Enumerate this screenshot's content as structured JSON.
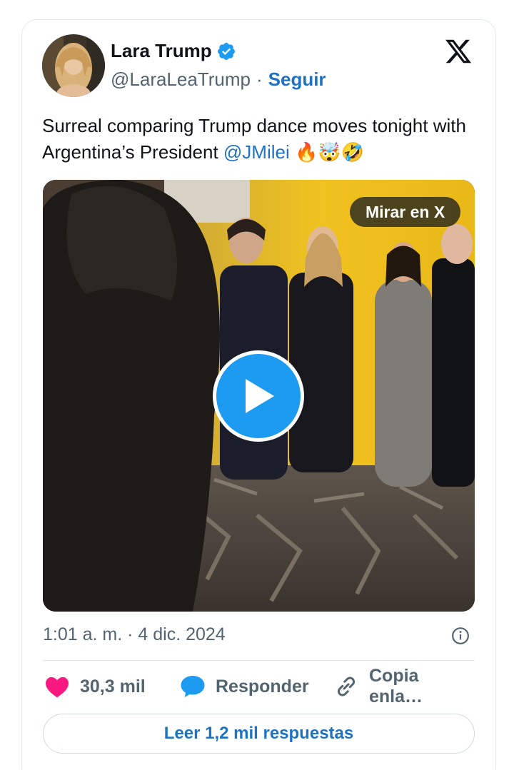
{
  "tweet": {
    "author_name": "Lara Trump",
    "author_handle": "@LaraLeaTrump",
    "separator": "·",
    "follow_label": "Seguir",
    "text_part1": "Surreal comparing Trump dance moves tonight with Argentina’s President ",
    "mention": "@JMilei",
    "emojis": " 🔥🤯🤣",
    "watch_label": "Mirar en X",
    "timestamp": "1:01 a. m. · 4 dic. 2024",
    "likes": "30,3 mil",
    "reply_label": "Responder",
    "copy_label": "Copia enla…",
    "read_replies_label": "Leer 1,2 mil respuestas"
  },
  "colors": {
    "link": "#1d72c2",
    "heart": "#f91880",
    "reply_bubble": "#1d9bf0",
    "play_button": "#1d9bf0"
  },
  "icons": [
    "verified-badge-icon",
    "x-logo-icon",
    "play-icon",
    "info-icon",
    "heart-icon",
    "reply-bubble-icon",
    "link-icon"
  ]
}
